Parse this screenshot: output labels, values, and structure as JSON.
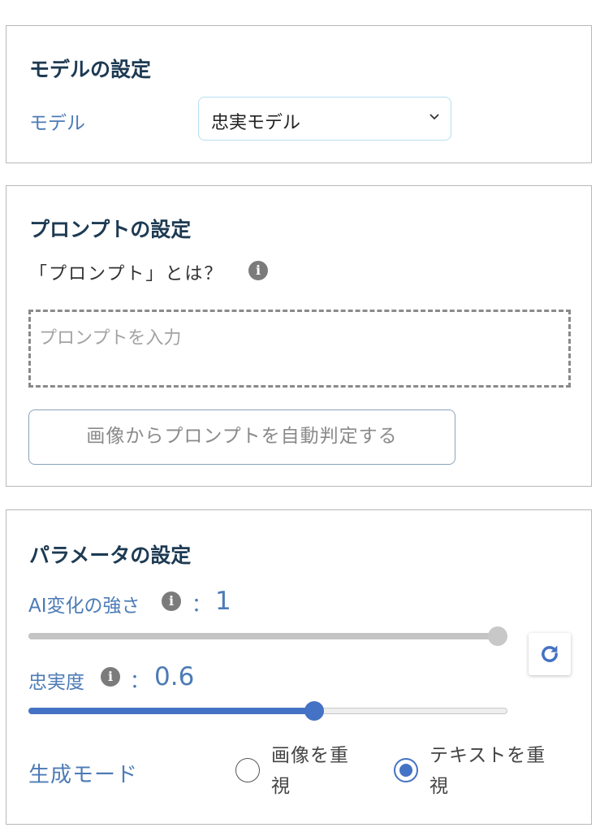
{
  "model_section": {
    "title": "モデルの設定",
    "model_label": "モデル",
    "model_selected": "忠実モデル"
  },
  "prompt_section": {
    "title": "プロンプトの設定",
    "help_text": "「プロンプト」とは？",
    "prompt_placeholder": "プロンプトを入力",
    "auto_button_label": "画像からプロンプトを自動判定する"
  },
  "param_section": {
    "title": "パラメータの設定",
    "ai_strength_label": "AI変化の強さ",
    "ai_strength_colon": "：",
    "ai_strength_value": "1",
    "ai_strength_level": 1.0,
    "fidelity_label": "忠実度",
    "fidelity_colon": "：",
    "fidelity_value": "0.6",
    "fidelity_level": 0.6,
    "mode_label": "生成モード",
    "mode_options": [
      {
        "label_line1": "画像を重",
        "label_line2": "視",
        "selected": false
      },
      {
        "label_line1": "テキストを重",
        "label_line2": "視",
        "selected": true
      }
    ]
  },
  "colors": {
    "accent": "#4472c4",
    "label_blue": "#4c7bb6",
    "title": "#1d3a52"
  },
  "icons": {
    "info": "info-icon",
    "reset": "refresh-icon",
    "dropdown": "chevron-down-icon"
  }
}
